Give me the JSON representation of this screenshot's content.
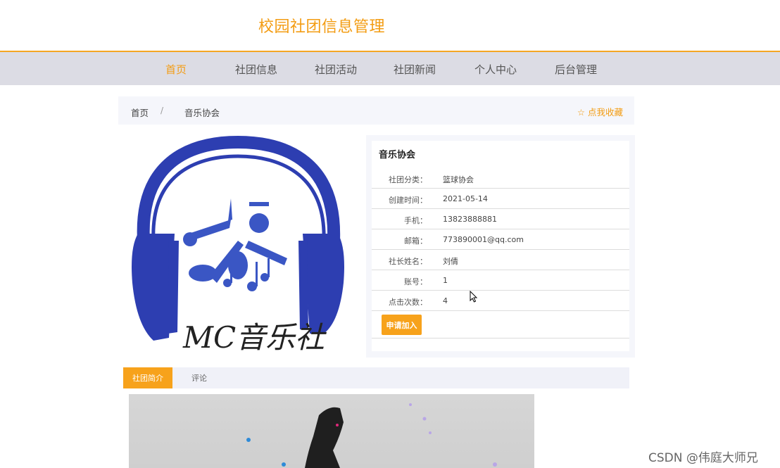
{
  "header": {
    "title": "校园社团信息管理"
  },
  "nav": {
    "items": [
      {
        "label": "首页",
        "active": true
      },
      {
        "label": "社团信息",
        "active": false
      },
      {
        "label": "社团活动",
        "active": false
      },
      {
        "label": "社团新闻",
        "active": false
      },
      {
        "label": "个人中心",
        "active": false
      },
      {
        "label": "后台管理",
        "active": false
      }
    ]
  },
  "breadcrumb": {
    "home": "首页",
    "separator": "/",
    "current": "音乐协会",
    "favorite_label": "☆ 点我收藏"
  },
  "logo": {
    "text": "MC音乐社",
    "icon": "headphones-music-logo"
  },
  "club": {
    "name": "音乐协会",
    "rows": [
      {
        "label": "社团分类：",
        "value": "篮球协会"
      },
      {
        "label": "创建时间：",
        "value": "2021-05-14"
      },
      {
        "label": "手机：",
        "value": "13823888881"
      },
      {
        "label": "邮箱：",
        "value": "773890001@qq.com"
      },
      {
        "label": "社长姓名：",
        "value": "刘倩"
      },
      {
        "label": "账号：",
        "value": "1"
      },
      {
        "label": "点击次数：",
        "value": "4"
      }
    ],
    "join_label": "申请加入"
  },
  "tabs": {
    "intro": "社团简介",
    "comments": "评论"
  },
  "watermark": "CSDN @伟庭大师兄",
  "colors": {
    "accent": "#f39c12",
    "logo_blue": "#2d3eb1",
    "nav_bg": "#dcdce4"
  }
}
